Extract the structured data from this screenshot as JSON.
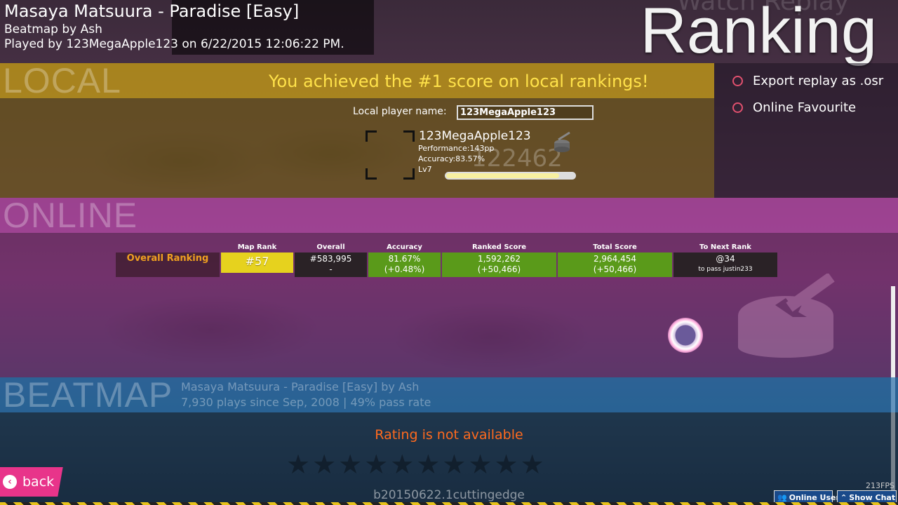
{
  "header": {
    "title": "Masaya Matsuura - Paradise [Easy]",
    "beatmap_by": "Beatmap by Ash",
    "played_by": "Played by 123MegaApple123 on 6/22/2015 12:06:22 PM.",
    "ranking": "Ranking",
    "watch_replay_ghost": "Watch Replay"
  },
  "local": {
    "section_label": "LOCAL",
    "achievement": "You achieved the #1 score on local rankings!",
    "player_name_label": "Local player name:",
    "player_name_value": "123MegaApple123",
    "card": {
      "name": "123MegaApple123",
      "performance": "Performance:143pp",
      "accuracy": "Accuracy:83.57%",
      "level": "Lv7",
      "score_ghost": "122462",
      "level_progress": 0.88
    }
  },
  "side_menu": {
    "items": [
      {
        "label": "Export replay as .osr"
      },
      {
        "label": "Online Favourite"
      }
    ]
  },
  "online": {
    "section_label": "ONLINE",
    "overall_label": "Overall Ranking",
    "columns": [
      {
        "head": "Map Rank",
        "line1": "#57",
        "line2": ""
      },
      {
        "head": "Overall",
        "line1": "#583,995",
        "line2": "-"
      },
      {
        "head": "Accuracy",
        "line1": "81.67%",
        "line2": "(+0.48%)"
      },
      {
        "head": "Ranked Score",
        "line1": "1,592,262",
        "line2": "(+50,466)"
      },
      {
        "head": "Total Score",
        "line1": "2,964,454",
        "line2": "(+50,466)"
      },
      {
        "head": "To Next Rank",
        "line1": "@34",
        "line2": "to pass justin233"
      }
    ],
    "colors": {
      "map_rank": "#e6d21e",
      "green": "#5a9a1a",
      "dark": "#2a2226"
    }
  },
  "beatmap": {
    "section_label": "BEATMAP",
    "title": "Masaya Matsuura - Paradise [Easy] by Ash",
    "plays": "7,930 plays since Sep, 2008 | 49% pass rate",
    "rating": "Rating is not available",
    "stars": "★★★★★★★★★★"
  },
  "footer": {
    "back": "back",
    "version": "b20150622.1cuttingedge",
    "online_users": "Online Users",
    "show_chat": "Show Chat",
    "fps": "213FPS"
  }
}
